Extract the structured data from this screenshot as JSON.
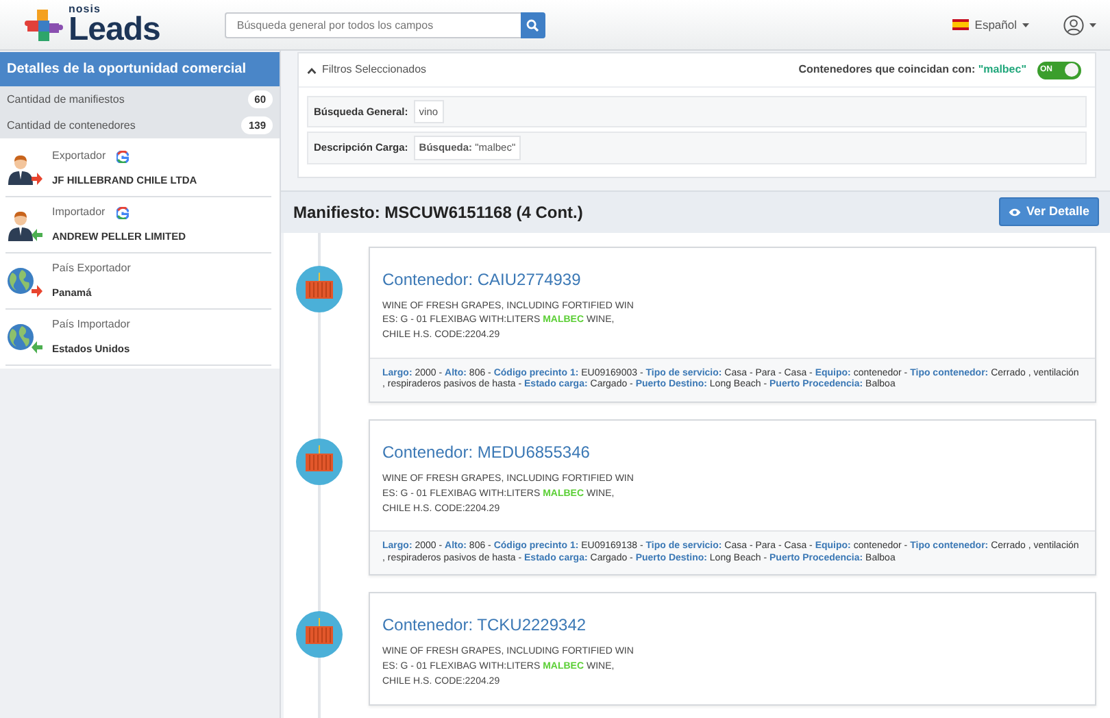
{
  "navbar": {
    "logo": {
      "small": "nosis",
      "main": "Leads"
    },
    "search": {
      "placeholder": "Búsqueda general por todos los campos"
    },
    "language": "Español"
  },
  "sidebar": {
    "title": "Detalles de la oportunidad comercial",
    "stats": [
      {
        "label": "Cantidad de manifiestos",
        "count": "60"
      },
      {
        "label": "Cantidad de contenedores",
        "count": "139"
      }
    ],
    "items": [
      {
        "kind": "person",
        "outgoing": true,
        "google": true,
        "label": "Exportador",
        "value": "JF HILLEBRAND CHILE LTDA"
      },
      {
        "kind": "person",
        "outgoing": false,
        "google": true,
        "label": "Importador",
        "value": "ANDREW PELLER LIMITED"
      },
      {
        "kind": "globe",
        "outgoing": true,
        "google": false,
        "label": "País Exportador",
        "value": "Panamá"
      },
      {
        "kind": "globe",
        "outgoing": false,
        "google": false,
        "label": "País Importador",
        "value": "Estados Unidos"
      }
    ]
  },
  "filters": {
    "title": "Filtros Seleccionados",
    "expanded": true,
    "toggle": {
      "label": "Contenedores que coincidan con:",
      "term": "\"malbec\"",
      "on": true,
      "text": "ON"
    },
    "rows": [
      {
        "label": "Búsqueda General:",
        "value": "vino"
      },
      {
        "label": "Descripción Carga:",
        "value": "**Búsqueda:** \"malbec\""
      }
    ]
  },
  "manifest": {
    "title": "Manifiesto: MSCUW6151168 (4 Cont.)",
    "button": "Ver Detalle",
    "containers": [
      {
        "title": "Contenedor: CAIU2774939",
        "description": [
          [
            {
              "text": "WINE OF FRESH GRAPES, INCLUDING FORTIFIED WIN",
              "highlight": false
            }
          ],
          [
            {
              "text": "ES: G - 01 FLEXIBAG WITH:LITERS",
              "highlight": false
            },
            {
              "text": "MALBEC",
              "highlight": true
            },
            {
              "text": "WINE,",
              "highlight": false
            }
          ],
          [
            {
              "text": "CHILE H.S. CODE:2204.29",
              "highlight": false
            }
          ]
        ],
        "details": [
          {
            "label": "Largo:",
            "value": "2000 -"
          },
          {
            "label": "Alto:",
            "value": "806 -"
          },
          {
            "label": "Código precinto 1:",
            "value": "EU09169003 -"
          },
          {
            "label": "Tipo de servicio:",
            "value": "Casa - Para - Casa -"
          },
          {
            "label": "Equipo:",
            "value": "contenedor -"
          },
          {
            "label": "Tipo contenedor:",
            "value": "Cerrado , ventilación , respiraderos pasivos de hasta -"
          },
          {
            "label": "Estado carga:",
            "value": "Cargado -"
          },
          {
            "label": "Puerto Destino:",
            "value": "Long Beach -"
          },
          {
            "label": "Puerto Procedencia:",
            "value": "Balboa"
          }
        ]
      },
      {
        "title": "Contenedor: MEDU6855346",
        "description": [
          [
            {
              "text": "WINE OF FRESH GRAPES, INCLUDING FORTIFIED WIN",
              "highlight": false
            }
          ],
          [
            {
              "text": "ES: G - 01 FLEXIBAG WITH:LITERS",
              "highlight": false
            },
            {
              "text": "MALBEC",
              "highlight": true
            },
            {
              "text": "WINE,",
              "highlight": false
            }
          ],
          [
            {
              "text": "CHILE H.S. CODE:2204.29",
              "highlight": false
            }
          ]
        ],
        "details": [
          {
            "label": "Largo:",
            "value": "2000 -"
          },
          {
            "label": "Alto:",
            "value": "806 -"
          },
          {
            "label": "Código precinto 1:",
            "value": "EU09169138 -"
          },
          {
            "label": "Tipo de servicio:",
            "value": "Casa - Para - Casa -"
          },
          {
            "label": "Equipo:",
            "value": "contenedor -"
          },
          {
            "label": "Tipo contenedor:",
            "value": "Cerrado , ventilación , respiraderos pasivos de hasta -"
          },
          {
            "label": "Estado carga:",
            "value": "Cargado -"
          },
          {
            "label": "Puerto Destino:",
            "value": "Long Beach -"
          },
          {
            "label": "Puerto Procedencia:",
            "value": "Balboa"
          }
        ]
      },
      {
        "title": "Contenedor: TCKU2229342",
        "description": [
          [
            {
              "text": "WINE OF FRESH GRAPES, INCLUDING FORTIFIED WIN",
              "highlight": false
            }
          ],
          [
            {
              "text": "ES: G - 01 FLEXIBAG WITH:LITERS",
              "highlight": false
            },
            {
              "text": "MALBEC",
              "highlight": true
            },
            {
              "text": "WINE,",
              "highlight": false
            }
          ],
          [
            {
              "text": "CHILE H.S. CODE:2204.29",
              "highlight": false
            }
          ]
        ]
      }
    ]
  }
}
